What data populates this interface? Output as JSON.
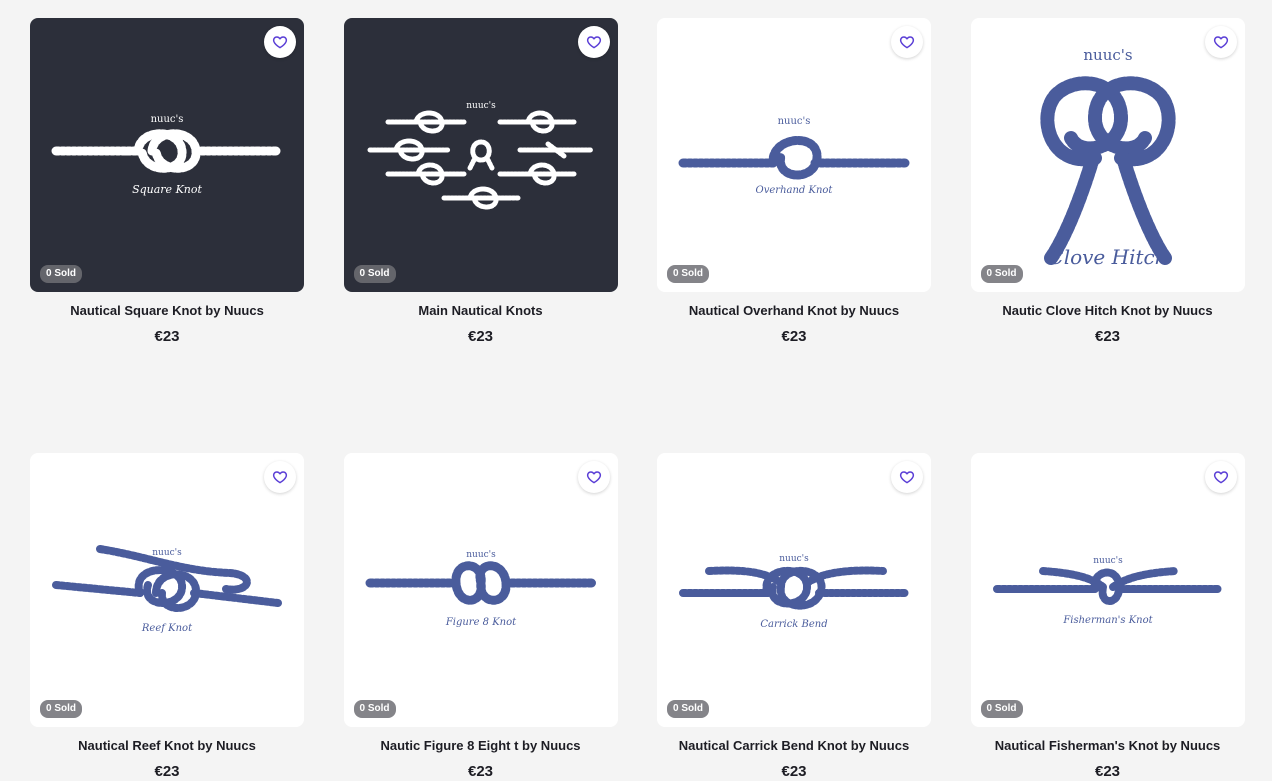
{
  "accent_color": "#5b3fd6",
  "rope_color_light": "#ffffff",
  "rope_color_blue": "#4a5c9c",
  "products": [
    {
      "title": "Nautical Square Knot by Nuucs",
      "price": "€23",
      "sold": "0 Sold",
      "theme": "dark",
      "art_brand": "nuuc's",
      "art_caption": "Square Knot",
      "favorite_icon": "heart-icon"
    },
    {
      "title": "Main Nautical Knots",
      "price": "€23",
      "sold": "0 Sold",
      "theme": "dark",
      "art_brand": "nuuc's",
      "art_caption": "",
      "favorite_icon": "heart-icon"
    },
    {
      "title": "Nautical Overhand Knot by Nuucs",
      "price": "€23",
      "sold": "0 Sold",
      "theme": "light",
      "art_brand": "nuuc's",
      "art_caption": "Overhand Knot",
      "favorite_icon": "heart-icon"
    },
    {
      "title": "Nautic Clove Hitch Knot by Nuucs",
      "price": "€23",
      "sold": "0 Sold",
      "theme": "light",
      "art_brand": "nuuc's",
      "art_caption": "Clove Hitch",
      "favorite_icon": "heart-icon"
    },
    {
      "title": "Nautical Reef Knot by Nuucs",
      "price": "€23",
      "sold": "0 Sold",
      "theme": "light",
      "art_brand": "nuuc's",
      "art_caption": "Reef Knot",
      "favorite_icon": "heart-icon"
    },
    {
      "title": "Nautic Figure 8 Eight t by Nuucs",
      "price": "€23",
      "sold": "0 Sold",
      "theme": "light",
      "art_brand": "nuuc's",
      "art_caption": "Figure 8 Knot",
      "favorite_icon": "heart-icon"
    },
    {
      "title": "Nautical Carrick Bend Knot by Nuucs",
      "price": "€23",
      "sold": "0 Sold",
      "theme": "light",
      "art_brand": "nuuc's",
      "art_caption": "Carrick Bend",
      "favorite_icon": "heart-icon"
    },
    {
      "title": "Nautical Fisherman's Knot by Nuucs",
      "price": "€23",
      "sold": "0 Sold",
      "theme": "light",
      "art_brand": "nuuc's",
      "art_caption": "Fisherman's Knot",
      "favorite_icon": "heart-icon"
    }
  ]
}
